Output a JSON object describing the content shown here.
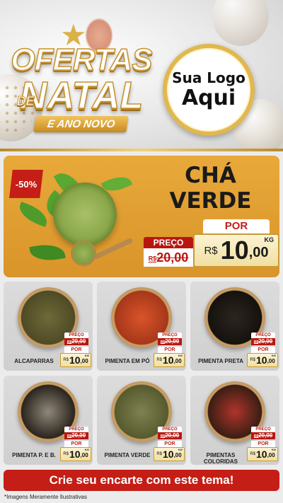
{
  "header": {
    "title_line1": "OFERTAS",
    "title_de": "DE",
    "title_line2": "NATAL",
    "title_ribbon": "E ANO NOVO",
    "logo_line1": "Sua Logo",
    "logo_line2": "Aqui"
  },
  "featured": {
    "discount": "-50%",
    "name": "CHÁ\nVERDE",
    "preco_label": "PREÇO",
    "old_currency": "R$",
    "old_price": "20,00",
    "por_label": "POR",
    "new_currency": "R$",
    "new_price_int": "10",
    "new_price_dec": ",00",
    "unit": "KG"
  },
  "products": [
    {
      "name": "ALCAPARRAS",
      "preco_label": "PREÇO",
      "old_currency": "R$",
      "old_price": "20,00",
      "por_label": "POR",
      "new_currency": "R$",
      "new_price_int": "10",
      "new_price_dec": ",00",
      "unit": "KG",
      "color_center": "#6f6a3a",
      "color_edge": "#4e4a24"
    },
    {
      "name": "PIMENTA EM PÓ",
      "preco_label": "PREÇO",
      "old_currency": "R$",
      "old_price": "20,00",
      "por_label": "POR",
      "new_currency": "R$",
      "new_price_int": "10",
      "new_price_dec": ",00",
      "unit": "KG",
      "color_center": "#d9542a",
      "color_edge": "#a6371a"
    },
    {
      "name": "PIMENTA PRETA",
      "preco_label": "PREÇO",
      "old_currency": "R$",
      "old_price": "20,00",
      "por_label": "POR",
      "new_currency": "R$",
      "new_price_int": "10",
      "new_price_dec": ",00",
      "unit": "KG",
      "color_center": "#2c2620",
      "color_edge": "#15110d"
    },
    {
      "name": "PIMENTA P. E B.",
      "preco_label": "PREÇO",
      "old_currency": "R$",
      "old_price": "20,00",
      "por_label": "POR",
      "new_currency": "R$",
      "new_price_int": "10",
      "new_price_dec": ",00",
      "unit": "KG",
      "color_center": "#8f8778",
      "color_edge": "#2a241d"
    },
    {
      "name": "PIMENTA VERDE",
      "preco_label": "PREÇO",
      "old_currency": "R$",
      "old_price": "20,00",
      "por_label": "POR",
      "new_currency": "R$",
      "new_price_int": "10",
      "new_price_dec": ",00",
      "unit": "KG",
      "color_center": "#7f8250",
      "color_edge": "#565a2e"
    },
    {
      "name": "PIMENTAS COLORIDAS",
      "preco_label": "PREÇO",
      "old_currency": "R$",
      "old_price": "20,00",
      "por_label": "POR",
      "new_currency": "R$",
      "new_price_int": "10",
      "new_price_dec": ",00",
      "unit": "KG",
      "color_center": "#b0342a",
      "color_edge": "#3a1e14"
    }
  ],
  "footer": {
    "cta": "Crie seu encarte com este tema!",
    "disclaimer": "*Imagens Meramente Ilustrativas"
  },
  "colors": {
    "accent_red": "#c41e16",
    "featured_bg": "#e8a93a",
    "gold": "#e0b84e"
  }
}
